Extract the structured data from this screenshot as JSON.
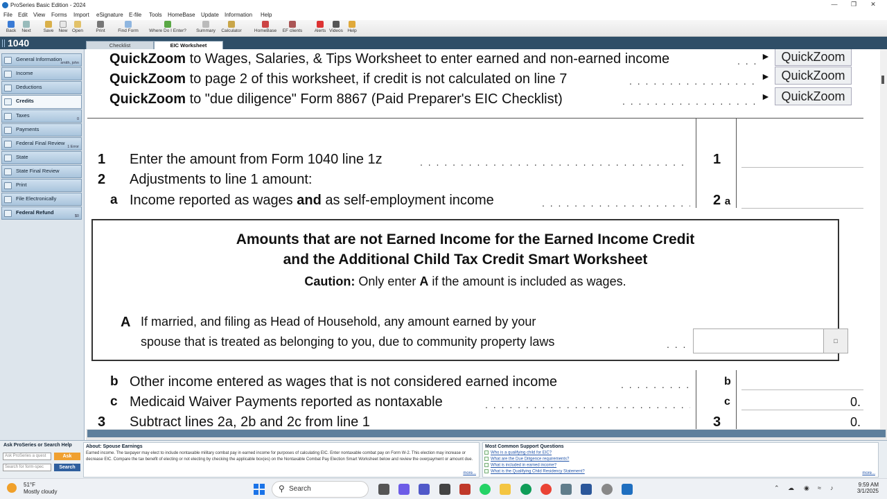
{
  "window": {
    "title": "ProSeries Basic Edition - 2024"
  },
  "menu": [
    "File",
    "Edit",
    "View",
    "Forms",
    "Import",
    "eSignature",
    "E-file",
    "Tools",
    "HomeBase",
    "Update",
    "Information",
    "Help"
  ],
  "toolbar": [
    "Back",
    "Next",
    "Save",
    "New",
    "Open",
    "Print",
    "Find Form",
    "Where Do I Enter?",
    "Summary",
    "Calculator",
    "HomeBase",
    "EF clients",
    "Alerts",
    "Videos",
    "Help"
  ],
  "form_name": "1040",
  "tabs": {
    "checklist": "Checklist",
    "eic": "EIC Worksheet"
  },
  "nav": [
    {
      "label": "General Information",
      "sub": "smith, john"
    },
    {
      "label": "Income",
      "sub": ""
    },
    {
      "label": "Deductions",
      "sub": ""
    },
    {
      "label": "Credits",
      "sub": ""
    },
    {
      "label": "Taxes",
      "sub": "0"
    },
    {
      "label": "Payments",
      "sub": ""
    },
    {
      "label": "Federal Final Review",
      "sub": "1 Error"
    },
    {
      "label": "State",
      "sub": ""
    },
    {
      "label": "State Final Review",
      "sub": ""
    },
    {
      "label": "Print",
      "sub": ""
    },
    {
      "label": "File Electronically",
      "sub": ""
    },
    {
      "label": "Federal Refund",
      "sub": "$0"
    }
  ],
  "quickzoom": {
    "label": "QuickZoom",
    "rows": [
      {
        "bold": "QuickZoom",
        "text": " to Wages, Salaries, & Tips Worksheet to enter earned and non-earned income"
      },
      {
        "bold": "QuickZoom",
        "text": " to page 2 of this worksheet, if credit is not calculated on line 7"
      },
      {
        "bold": "QuickZoom",
        "text": " to  \"due diligence\" Form 8867 (Paid Preparer's EIC Checklist)"
      }
    ]
  },
  "lines": {
    "l1": {
      "num": "1",
      "text": "Enter the amount from Form 1040 line 1z",
      "ref": "1",
      "value": ""
    },
    "l2": {
      "num": "2",
      "text": "Adjustments to line 1 amount:"
    },
    "l2a": {
      "letter": "a",
      "text_pre": "Income reported as wages ",
      "text_bold": "and",
      "text_post": " as self-employment income",
      "ref": "2",
      "ref_letter": "a",
      "value": ""
    },
    "l2b": {
      "letter": "b",
      "text": "Other income entered as wages that is not considered earned income",
      "ref": "b",
      "value": ""
    },
    "l2c": {
      "letter": "c",
      "text": "Medicaid Waiver Payments reported as nontaxable",
      "ref": "c",
      "value": "0."
    },
    "l3": {
      "num": "3",
      "text": "Subtract lines 2a, 2b and 2c from line 1",
      "ref": "3",
      "value": "0."
    }
  },
  "smart": {
    "title1": "Amounts that are not Earned Income for the Earned Income Credit",
    "title2": "and the Additional Child Tax Credit Smart Worksheet",
    "caution_bold": "Caution:",
    "caution_pre": "  Only enter ",
    "caution_a": "A",
    "caution_post": " if the amount is included as wages.",
    "a_label": "A",
    "a_line1": "If married, and filing as Head of Household, any amount earned by your",
    "a_line2": "spouse that is treated as belonging to you, due to community property laws",
    "a_value": ""
  },
  "help": {
    "heading": "Ask ProSeries or Search Help",
    "ask_placeholder": "Ask ProSeries a quest",
    "ask_btn": "Ask",
    "search_placeholder": "Search for form-spec",
    "search_btn": "Search"
  },
  "about": {
    "heading": "About: Spouse Earnings",
    "text": "Earned income. The taxpayer  may elect  to include nontaxable military combat pay in earned income for purposes of calculating EIC. Enter nontaxable combat pay on Form W-2. This election may increase or decrease EIC. Compare the tax benefit of electing or not electing by checking the applicable box(es) on the Nontaxable Combat Pay Election Smart Worksheet below and review the overpayment or amount due.",
    "more": "more..."
  },
  "support": {
    "heading": "Most Common Support Questions",
    "questions": [
      "Who is a qualifying child for EIC?",
      "What are the Due Diligence requirements?",
      "What is included in earned income?",
      "What is the Qualifying Child Residency Statement?"
    ],
    "more": "more..."
  },
  "taskbar": {
    "weather_temp": "51°F",
    "weather_cond": "Mostly cloudy",
    "search": "Search",
    "time": "9:59 AM",
    "date": "3/1/2025"
  },
  "colors": {
    "nav_blue": "#2f4e67",
    "accent_orange": "#f0a030",
    "link": "#2255aa"
  }
}
